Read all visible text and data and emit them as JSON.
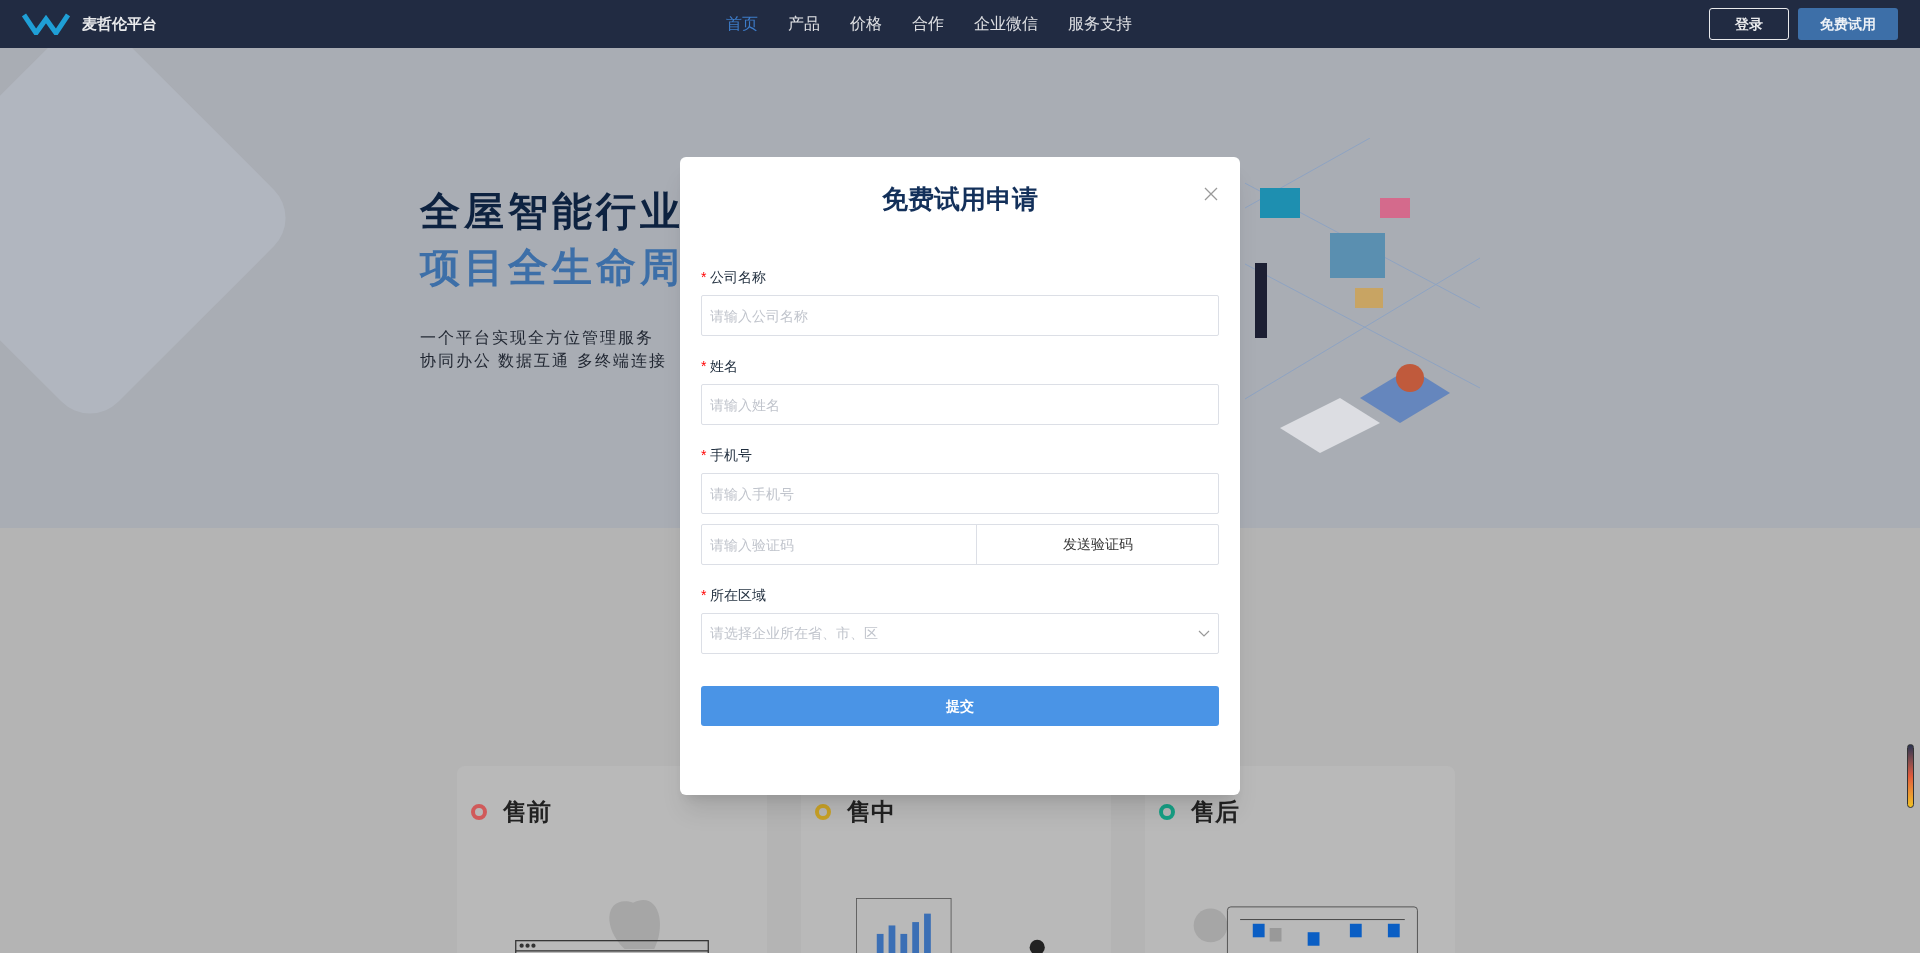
{
  "navbar": {
    "brand": "麦哲伦平台",
    "items": [
      {
        "label": "首页",
        "selected": true
      },
      {
        "label": "产品",
        "selected": false
      },
      {
        "label": "价格",
        "selected": false
      },
      {
        "label": "合作",
        "selected": false
      },
      {
        "label": "企业微信",
        "selected": false
      },
      {
        "label": "服务支持",
        "selected": false
      }
    ],
    "login_button": "登录",
    "trial_button": "免费试用"
  },
  "hero": {
    "title_lines": [
      "全屋智能行业",
      "项目全生命周"
    ],
    "subtitle_lines": [
      "一个平台实现全方位管理服务",
      "协同办公 数据互通 多终端连接"
    ]
  },
  "cards": [
    {
      "title": "售前",
      "color": "#d05a5a"
    },
    {
      "title": "售中",
      "color": "#c9a227"
    },
    {
      "title": "售后",
      "color": "#17a085"
    }
  ],
  "dialog": {
    "title": "免费试用申请",
    "fields": [
      {
        "kind": "text",
        "label": "公司名称",
        "required_mark": "*",
        "placeholder": "请输入公司名称"
      },
      {
        "kind": "text",
        "label": "姓名",
        "required_mark": "*",
        "placeholder": "请输入姓名"
      },
      {
        "kind": "text",
        "label": "手机号",
        "required_mark": "*",
        "placeholder": "请输入手机号"
      },
      {
        "kind": "code",
        "placeholder": "请输入验证码",
        "button": "发送验证码"
      },
      {
        "kind": "select",
        "label": "所在区域",
        "required_mark": "*",
        "placeholder": "请选择企业所在省、市、区"
      }
    ],
    "submit": "提交"
  }
}
